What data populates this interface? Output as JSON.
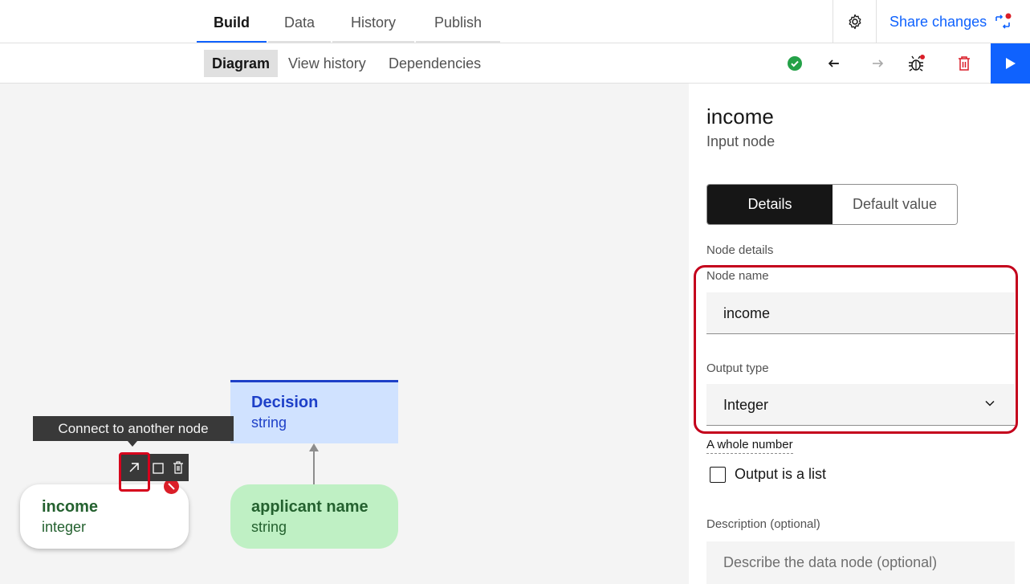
{
  "header": {
    "tabs": [
      {
        "label": "Build",
        "active": true
      },
      {
        "label": "Data",
        "active": false
      },
      {
        "label": "History",
        "active": false
      },
      {
        "label": "Publish",
        "active": false
      }
    ],
    "settings_icon": "gear-icon",
    "share_label": "Share changes",
    "share_icon": "share-changes-icon"
  },
  "toolbar": {
    "subtabs": [
      {
        "label": "Diagram",
        "active": true
      },
      {
        "label": "View history",
        "active": false
      },
      {
        "label": "Dependencies",
        "active": false
      }
    ],
    "icons": [
      "check-circle-icon",
      "undo-icon",
      "redo-icon",
      "debug-icon",
      "trash-icon",
      "play-icon"
    ],
    "colors": {
      "accent": "#0f62fe",
      "success": "#24a148",
      "danger": "#da1e28"
    }
  },
  "canvas": {
    "tooltip": "Connect to another node",
    "node_tools": [
      "connect-arrow-icon",
      "copy-icon",
      "delete-icon"
    ],
    "nodes": [
      {
        "title": "Decision",
        "type": "string"
      },
      {
        "title": "applicant name",
        "type": "string"
      },
      {
        "title": "income",
        "type": "integer"
      }
    ]
  },
  "panel": {
    "title": "income",
    "subtitle": "Input node",
    "switcher": [
      "Details",
      "Default value"
    ],
    "section_label": "Node details",
    "node_name_label": "Node name",
    "node_name_value": "income",
    "output_type_label": "Output type",
    "output_type_value": "Integer",
    "output_type_helper": "A whole number",
    "output_list_label": "Output is a list",
    "output_list_checked": false,
    "description_label": "Description (optional)",
    "description_placeholder": "Describe the data node (optional)"
  }
}
